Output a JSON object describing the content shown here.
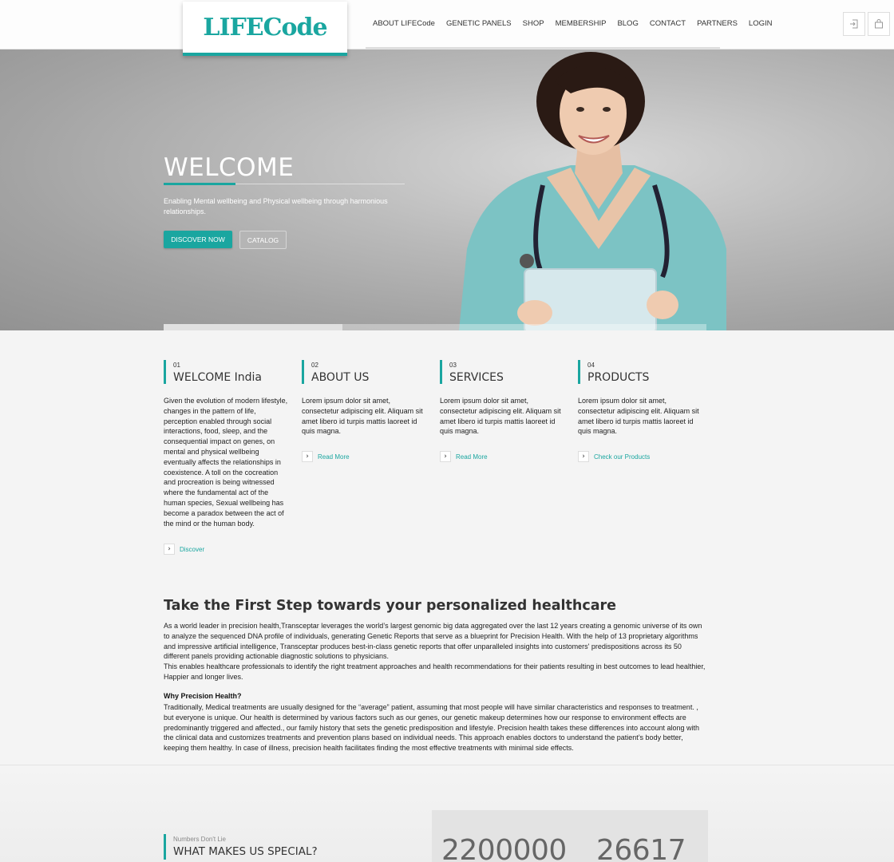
{
  "brand": {
    "logo": "LIFECode",
    "accent": "#1aa6a0"
  },
  "nav": {
    "items": [
      "ABOUT LIFECode",
      "GENETIC PANELS",
      "SHOP",
      "MEMBERSHIP",
      "BLOG",
      "CONTACT",
      "PARTNERS",
      "LOGIN"
    ]
  },
  "header_icons": [
    "login-icon",
    "cart-icon"
  ],
  "hero": {
    "title": "WELCOME",
    "subtitle": "Enabling Mental wellbeing and Physical wellbeing through harmonious relationships.",
    "primary_button": "DISCOVER NOW",
    "secondary_button": "CATALOG"
  },
  "features": [
    {
      "number": "01",
      "title": "WELCOME India",
      "text": "Given the evolution of modern lifestyle, changes in the pattern of life, perception enabled through social interactions, food, sleep, and the consequential impact on genes, on mental and physical wellbeing eventually affects the relationships in coexistence. A toll on the cocreation and procreation is being witnessed where the fundamental act of the human species, Sexual wellbeing has become a paradox between the act of the mind or the human body.",
      "link": "Discover"
    },
    {
      "number": "02",
      "title": "ABOUT US",
      "text": "Lorem ipsum dolor sit amet, consectetur adipiscing elit. Aliquam sit amet libero id turpis mattis laoreet id quis magna.",
      "link": "Read More"
    },
    {
      "number": "03",
      "title": "SERVICES",
      "text": "Lorem ipsum dolor sit amet, consectetur adipiscing elit. Aliquam sit amet libero id turpis mattis laoreet id quis magna.",
      "link": "Read More"
    },
    {
      "number": "04",
      "title": "PRODUCTS",
      "text": "Lorem ipsum dolor sit amet, consectetur adipiscing elit. Aliquam sit amet libero id turpis mattis laoreet id quis magna.",
      "link": "Check our Products"
    }
  ],
  "intro": {
    "title": "Take the First Step towards your personalized healthcare",
    "p1": "As a world leader in precision health,Transceptar leverages the world’s largest genomic big data aggregated over the last 12 years creating a genomic universe of its own to analyze the sequenced DNA profile of individuals, generating Genetic Reports that serve as a blueprint for Precision Health. With the help of 13 proprietary algorithms and impressive artificial intelligence, Transceptar produces best-in-class genetic reports that offer unparalleled insights into customers' predispositions across its 50 different panels providing actionable diagnostic solutions to physicians.",
    "p2": "This enables healthcare professionals to identify the right treatment approaches and health recommendations for their patients resulting in best outcomes to lead healthier, Happier and longer lives.",
    "why_title": "Why Precision Health?",
    "p3": "Traditionally, Medical treatments are usually designed for the “average” patient, assuming that most people will have similar characteristics and responses to treatment. , but everyone is unique. Our health is determined by various factors such as our genes, our genetic makeup determines how our response to environment effects are predominantly triggered and affected., our family history that sets the genetic predisposition and lifestyle. Precision health takes these differences into account along with the clinical data and customizes treatments and prevention plans based on individual needs. This approach enables doctors to understand the patient’s body better, keeping them healthy. In case of illness, precision health facilitates finding the most effective treatments with minimal side effects."
  },
  "numbers": {
    "eyebrow": "Numbers Don't Lie",
    "title": "WHAT MAKES US SPECIAL?",
    "stats": [
      "2200000",
      "26617"
    ]
  }
}
